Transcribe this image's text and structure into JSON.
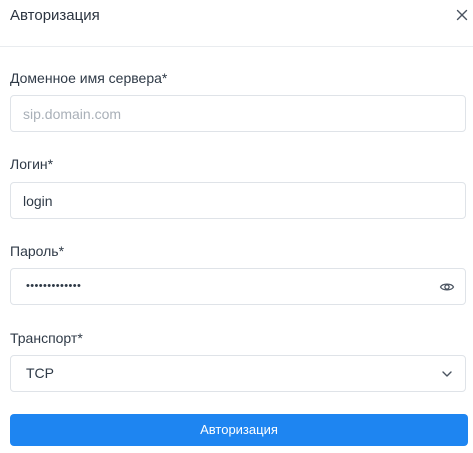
{
  "dialog": {
    "title": "Авторизация",
    "close_icon": "close-icon"
  },
  "form": {
    "server": {
      "label": "Доменное имя сервера*",
      "value": "",
      "placeholder": "sip.domain.com"
    },
    "login": {
      "label": "Логин*",
      "value": "login",
      "placeholder": ""
    },
    "password": {
      "label": "Пароль*",
      "masked_value": "•••••••••••••",
      "icon": "eye-icon"
    },
    "transport": {
      "label": "Транспорт*",
      "selected": "TCP",
      "icon": "chevron-down-icon"
    },
    "submit_label": "Авторизация"
  },
  "colors": {
    "accent": "#1e85f1",
    "border": "#dfe3e8",
    "text": "#2f3a47",
    "placeholder": "#a9b0b8"
  }
}
